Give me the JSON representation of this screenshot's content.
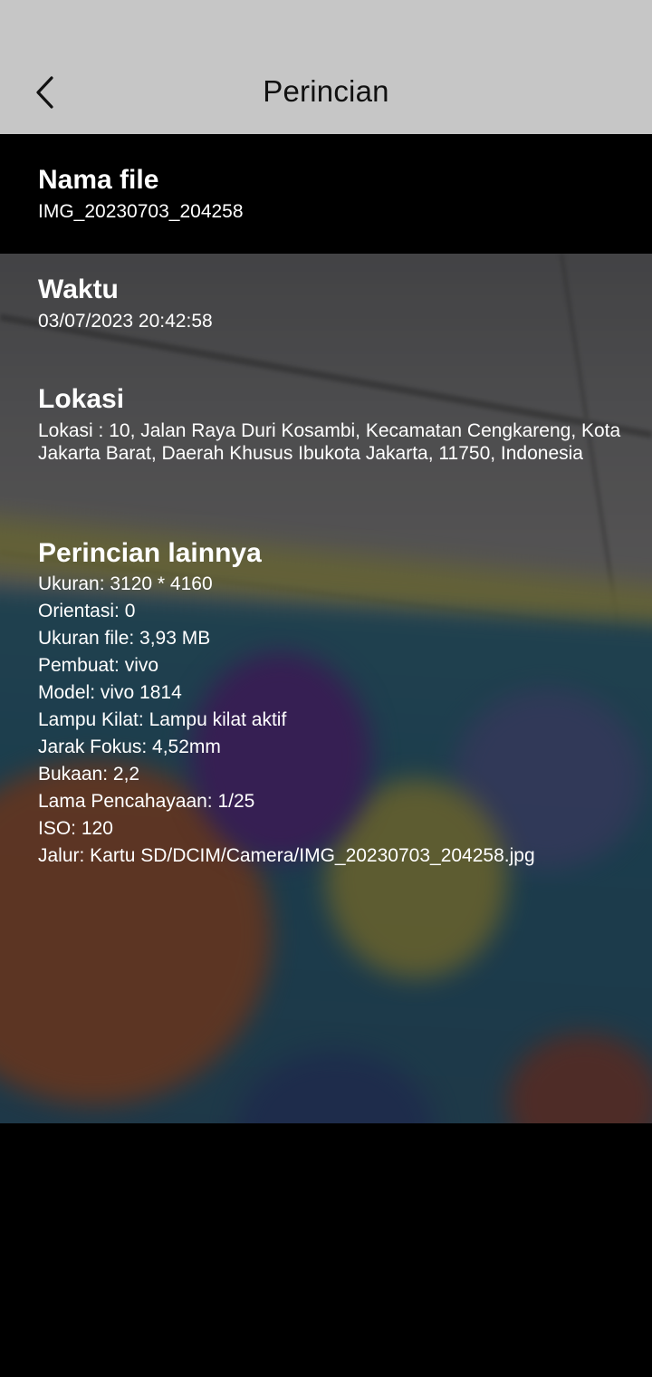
{
  "header": {
    "title": "Perincian",
    "back_icon": "chevron-left-icon"
  },
  "file": {
    "label": "Nama file",
    "value": "IMG_20230703_204258"
  },
  "time": {
    "label": "Waktu",
    "value": "03/07/2023 20:42:58"
  },
  "location": {
    "label": "Lokasi",
    "value": "Lokasi : 10, Jalan Raya Duri Kosambi, Kecamatan Cengkareng, Kota Jakarta Barat, Daerah Khusus Ibukota Jakarta, 11750, Indonesia"
  },
  "details": {
    "label": "Perincian lainnya",
    "rows": [
      "Ukuran: 3120 * 4160",
      "Orientasi: 0",
      "Ukuran file: 3,93 MB",
      "Pembuat: vivo",
      "Model: vivo 1814",
      "Lampu Kilat: Lampu kilat aktif",
      "Jarak Fokus: 4,52mm",
      "Bukaan: 2,2",
      "Lama Pencahayaan: 1/25",
      "ISO: 120",
      "Jalur: Kartu SD/DCIM/Camera/IMG_20230703_204258.jpg"
    ]
  }
}
